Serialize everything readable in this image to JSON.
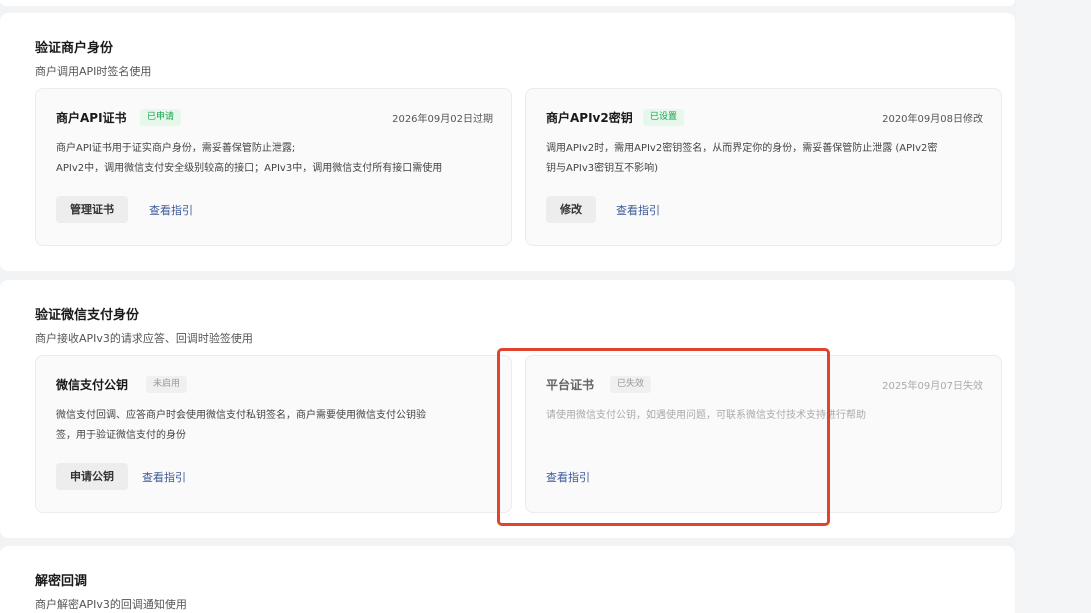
{
  "sections": [
    {
      "title": "验证商户身份",
      "subtitle": "商户调用API时签名使用",
      "cards": [
        {
          "title": "商户API证书",
          "badge": "已申请",
          "date": "2026年09月02日过期",
          "desc_line1": "商户API证书用于证实商户身份，需妥善保管防止泄露;",
          "desc_line2": "APIv2中，调用微信支付安全级别较高的接口；APIv3中，调用微信支付所有接口需使用",
          "button": "管理证书",
          "link": "查看指引"
        },
        {
          "title": "商户APIv2密钥",
          "badge": "已设置",
          "date": "2020年09月08日修改",
          "desc_line1": "调用APIv2时，需用APIv2密钥签名，从而界定你的身份，需妥善保管防止泄露 (APIv2密",
          "desc_line2": "钥与APIv3密钥互不影响)",
          "button": "修改",
          "link": "查看指引"
        }
      ]
    },
    {
      "title": "验证微信支付身份",
      "subtitle": "商户接收APIv3的请求应答、回调时验签使用",
      "cards": [
        {
          "title": "微信支付公钥",
          "badge": "未启用",
          "date": "",
          "desc_line1": "微信支付回调、应答商户时会使用微信支付私钥签名，商户需要使用微信支付公钥验",
          "desc_line2": "签，用于验证微信支付的身份",
          "button": "申请公钥",
          "link": "查看指引"
        },
        {
          "title": "平台证书",
          "badge": "已失效",
          "date": "2025年09月07日失效",
          "desc_line1": "请使用微信支付公钥，如遇使用问题，可联系微信支付技术支持进行帮助",
          "desc_line2": "",
          "button": "",
          "link": "查看指引"
        }
      ]
    },
    {
      "title": "解密回调",
      "subtitle": "商户解密APIv3的回调通知使用"
    }
  ],
  "colors": {
    "highlight": "#e0442e",
    "badge_green": "#16a34a",
    "link": "#3b5998"
  }
}
